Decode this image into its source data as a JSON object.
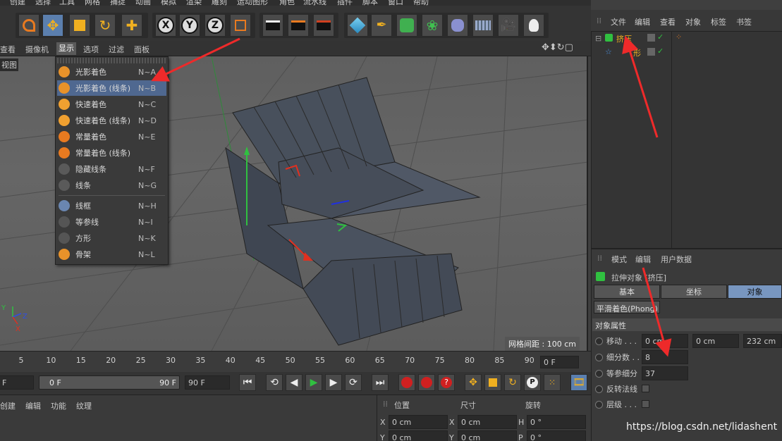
{
  "top_menu": [
    "创建",
    "选择",
    "工具",
    "网格",
    "捕捉",
    "动画",
    "模拟",
    "渲染",
    "雕刻",
    "运动图形",
    "角色",
    "流水线",
    "插件",
    "脚本",
    "窗口",
    "帮助"
  ],
  "viewport_menu": {
    "items": [
      "查看",
      "摄像机",
      "显示",
      "选项",
      "过滤",
      "面板"
    ],
    "active": "显示"
  },
  "viewport": {
    "label": "视图",
    "grid_info": "网格间距 : 100 cm"
  },
  "display_menu": [
    {
      "label": "光影着色",
      "shortcut": "N~A",
      "icon": "shaded-icon",
      "color": "#e8922a"
    },
    {
      "label": "光影着色 (线条)",
      "shortcut": "N~B",
      "icon": "shaded-lines-icon",
      "color": "#e8922a",
      "highlighted": true
    },
    {
      "label": "快速着色",
      "shortcut": "N~C",
      "icon": "quick-shading-icon",
      "color": "#f0a030"
    },
    {
      "label": "快速着色 (线条)",
      "shortcut": "N~D",
      "icon": "quick-shading-lines-icon",
      "color": "#f0a030"
    },
    {
      "label": "常量着色",
      "shortcut": "N~E",
      "icon": "constant-shading-icon",
      "color": "#e87a20"
    },
    {
      "label": "常量着色 (线条)",
      "shortcut": "",
      "icon": "constant-shading-lines-icon",
      "color": "#e87a20"
    },
    {
      "label": "隐藏线条",
      "shortcut": "N~F",
      "icon": "hidden-line-icon",
      "color": "#5a5a5a"
    },
    {
      "label": "线条",
      "shortcut": "N~G",
      "icon": "lines-icon",
      "color": "#5a5a5a"
    },
    {
      "label": "线框",
      "shortcut": "N~H",
      "icon": "wireframe-icon",
      "color": "#6a86b0"
    },
    {
      "label": "等参线",
      "shortcut": "N~I",
      "icon": "isoparms-icon",
      "color": "#555"
    },
    {
      "label": "方形",
      "shortcut": "N~K",
      "icon": "box-icon",
      "color": "#555"
    },
    {
      "label": "骨架",
      "shortcut": "N~L",
      "icon": "skeleton-icon",
      "color": "#e8922a"
    }
  ],
  "timeline": {
    "ticks": [
      "5",
      "10",
      "15",
      "20",
      "25",
      "30",
      "35",
      "40",
      "45",
      "50",
      "55",
      "60",
      "65",
      "70",
      "75",
      "80",
      "85",
      "90"
    ],
    "current_frame": "0 F",
    "start_field": "F",
    "range_start": "0 F",
    "range_end": "90 F",
    "end_field": "90 F"
  },
  "material_menu": [
    "创建",
    "编辑",
    "功能",
    "纹理"
  ],
  "coords": {
    "headers": [
      "位置",
      "尺寸",
      "旋转"
    ],
    "rows": [
      {
        "axis1": "X",
        "val1": "0 cm",
        "axis2": "X",
        "val2": "0 cm",
        "axis3": "H",
        "val3": "0 °"
      },
      {
        "axis1": "Y",
        "val1": "0 cm",
        "axis2": "Y",
        "val2": "0 cm",
        "axis3": "P",
        "val3": "0 °"
      }
    ]
  },
  "object_manager": {
    "menu": [
      "文件",
      "编辑",
      "查看",
      "对象",
      "标签",
      "书签"
    ],
    "objects": [
      {
        "name": "挤压",
        "icon": "extrude-icon"
      },
      {
        "name": "形",
        "icon": "star-spline-icon"
      }
    ]
  },
  "attribute_manager": {
    "menu": [
      "模式",
      "编辑",
      "用户数据"
    ],
    "title": "拉伸对象 [挤压]",
    "tabs": [
      "基本",
      "坐标",
      "对象"
    ],
    "active_tab": "对象",
    "phong": "平滑着色(Phong)",
    "section": "对象属性",
    "movement_label": "移动 . . .",
    "movement": [
      "0 cm",
      "0 cm",
      "232 cm"
    ],
    "subdivision_label": "细分数 . .",
    "subdivision": "8",
    "isoparm_label": "等参细分",
    "isoparm": "37",
    "flip_normals_label": "反转法线",
    "hierarchical_label": "层级 . . ."
  },
  "watermark": "https://blog.csdn.net/lidashent"
}
